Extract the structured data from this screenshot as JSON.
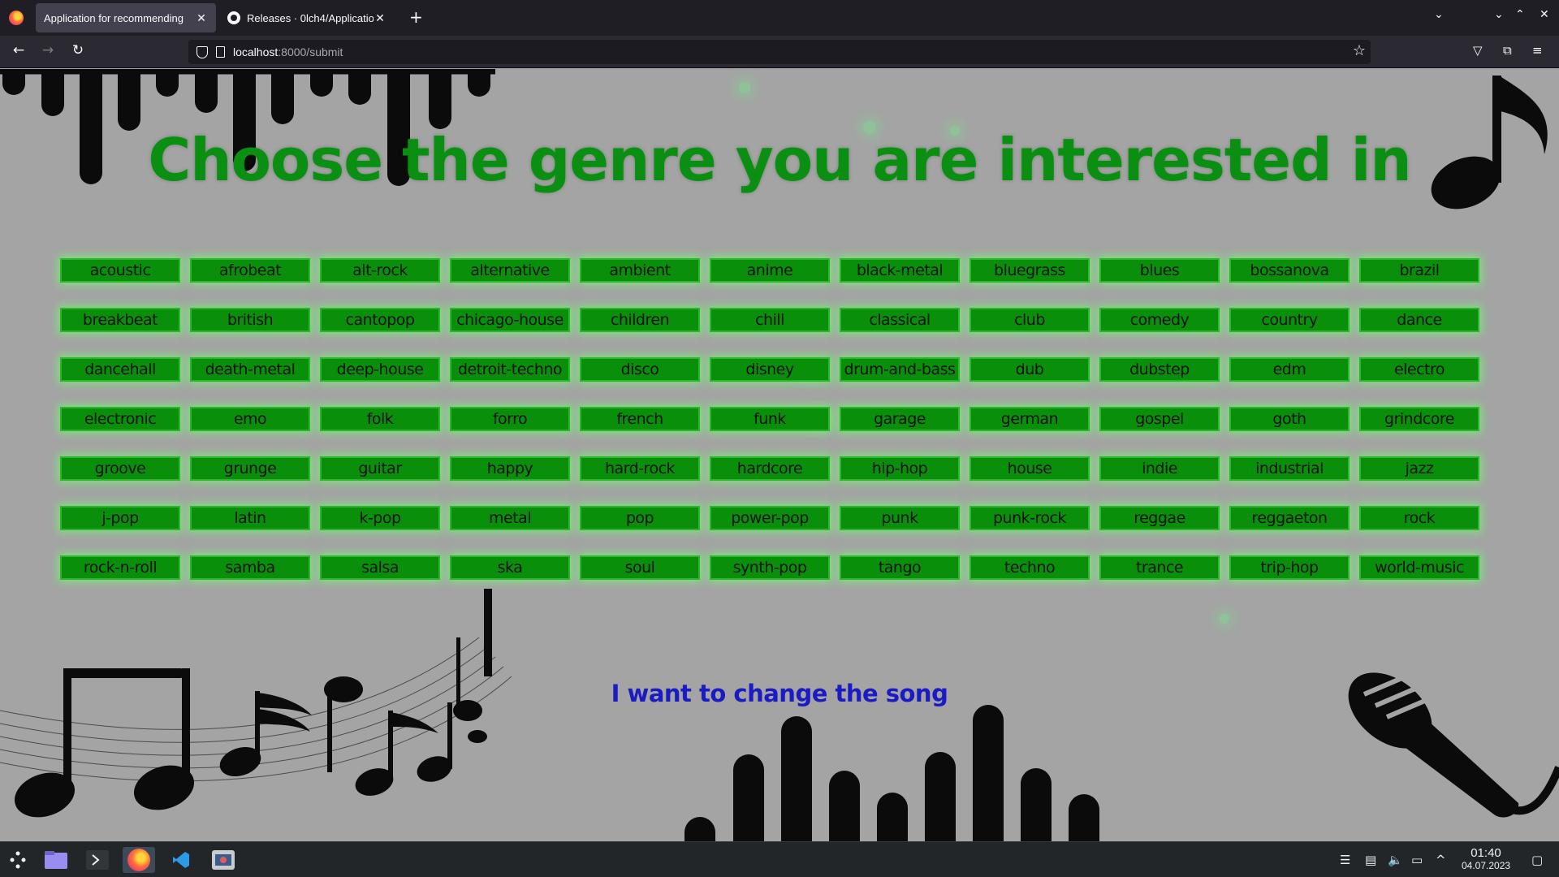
{
  "browser": {
    "tabs": [
      {
        "title": "Application for recommending",
        "active": true
      },
      {
        "title": "Releases · 0lch4/Applicatio",
        "active": false
      }
    ],
    "url": {
      "host": "localhost",
      "path": ":8000/submit"
    }
  },
  "page": {
    "heading": "Choose the genre you are interested in",
    "genres": [
      "acoustic",
      "afrobeat",
      "alt-rock",
      "alternative",
      "ambient",
      "anime",
      "black-metal",
      "bluegrass",
      "blues",
      "bossanova",
      "brazil",
      "breakbeat",
      "british",
      "cantopop",
      "chicago-house",
      "children",
      "chill",
      "classical",
      "club",
      "comedy",
      "country",
      "dance",
      "dancehall",
      "death-metal",
      "deep-house",
      "detroit-techno",
      "disco",
      "disney",
      "drum-and-bass",
      "dub",
      "dubstep",
      "edm",
      "electro",
      "electronic",
      "emo",
      "folk",
      "forro",
      "french",
      "funk",
      "garage",
      "german",
      "gospel",
      "goth",
      "grindcore",
      "groove",
      "grunge",
      "guitar",
      "happy",
      "hard-rock",
      "hardcore",
      "hip-hop",
      "house",
      "indie",
      "industrial",
      "jazz",
      "j-pop",
      "latin",
      "k-pop",
      "metal",
      "pop",
      "power-pop",
      "punk",
      "punk-rock",
      "reggae",
      "reggaeton",
      "rock",
      "rock-n-roll",
      "samba",
      "salsa",
      "ska",
      "soul",
      "synth-pop",
      "tango",
      "techno",
      "trance",
      "trip-hop",
      "world-music"
    ],
    "change_song_link": "I want to change the song",
    "colors": {
      "heading": "#0a8f12",
      "button_bg": "#0a8f0a",
      "button_glow": "#78f078",
      "link": "#1b1bc4",
      "background": "#a4a4a4"
    }
  },
  "taskbar": {
    "time": "01:40",
    "date": "04.07.2023"
  }
}
